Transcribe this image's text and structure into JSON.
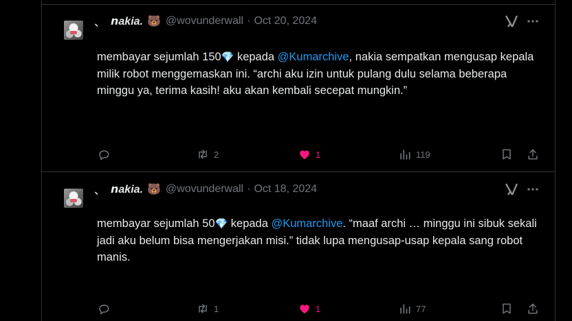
{
  "tweets": [
    {
      "display_name": "𝙣akia.",
      "name_prefix": "、",
      "name_emoji": "🐻",
      "handle": "@wovunderwall",
      "separator": "·",
      "date": "Oct 20, 2024",
      "body": {
        "part1": "membayar sejumlah 150",
        "gem": "💎",
        "part2": " kepada ",
        "mention": "@Kumarchive",
        "part3": ", nakia sempatkan mengusap kepala milik robot menggemaskan ini. “archi aku izin untuk pulang dulu selama beberapa minggu ya, terima kasih! aku akan kembali secepat mungkin.”"
      },
      "counts": {
        "replies": "",
        "reposts": "2",
        "likes": "1",
        "views": "119"
      }
    },
    {
      "display_name": "𝙣akia.",
      "name_prefix": "、",
      "name_emoji": "🐻",
      "handle": "@wovunderwall",
      "separator": "·",
      "date": "Oct 18, 2024",
      "body": {
        "part1": "membayar sejumlah 50",
        "gem": "💎",
        "part2": " kepada ",
        "mention": "@Kumarchive",
        "part3": ". “maaf archi … minggu ini sibuk sekali jadi aku belum bisa mengerjakan misi.” tidak lupa mengusap-usap kepala sang robot manis."
      },
      "counts": {
        "replies": "",
        "reposts": "1",
        "likes": "1",
        "views": "77"
      }
    }
  ],
  "icons": {
    "reply": "reply-icon",
    "repost": "repost-icon",
    "like": "heart-filled-icon",
    "views": "views-icon",
    "bookmark": "bookmark-icon",
    "share": "share-icon",
    "grok": "grok-icon",
    "more": "more-icon"
  },
  "colors": {
    "background": "#000000",
    "text": "#e7e9ea",
    "muted": "#71767b",
    "link": "#1d9bf0",
    "like": "#f91880",
    "border": "#2f3336"
  }
}
